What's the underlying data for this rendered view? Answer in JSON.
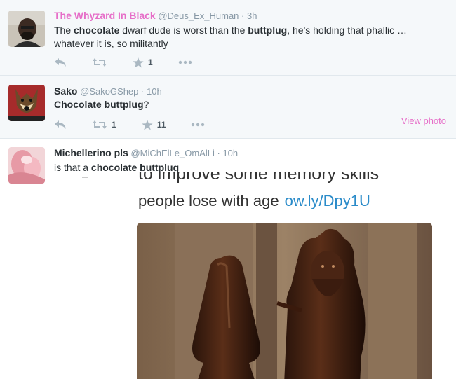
{
  "tweets": [
    {
      "fullname": "The Whyzard In Black",
      "username": "@Deus_Ex_Human",
      "sep": "·",
      "time": "3h",
      "text_parts": [
        "The ",
        "chocolate",
        " dwarf dude is worst than the ",
        "buttplug",
        ", he's holding that phallic …"
      ],
      "text_line2": "whatever it is, so militantly",
      "actions": {
        "reply": "",
        "retweet": "",
        "favorite_count": "1",
        "more": ""
      }
    },
    {
      "fullname": "Sako",
      "username": "@SakoGShep",
      "sep": "·",
      "time": "10h",
      "text_bold": "Chocolate buttplug",
      "text_rest": "?",
      "actions": {
        "reply": "",
        "retweet_count": "1",
        "favorite_count": "11",
        "more": ""
      },
      "view_photo": "View photo"
    },
    {
      "fullname": "Michellerino pls",
      "username": "@MiChElLe_OmAlLi",
      "sep": "·",
      "time": "10h",
      "text_plain": "is that a ",
      "text_bold": "chocolate buttplug",
      "embed": {
        "line1": "to improve some memory skills",
        "line2": "people lose with age",
        "link": "ow.ly/Dpy1U"
      }
    }
  ],
  "colors": {
    "visited_link": "#e66ec8",
    "muted": "#8899a6",
    "action_icon": "#aab8c2",
    "link": "#2a8bc9"
  },
  "icons": [
    "reply-icon",
    "retweet-icon",
    "favorite-icon",
    "more-icon"
  ]
}
